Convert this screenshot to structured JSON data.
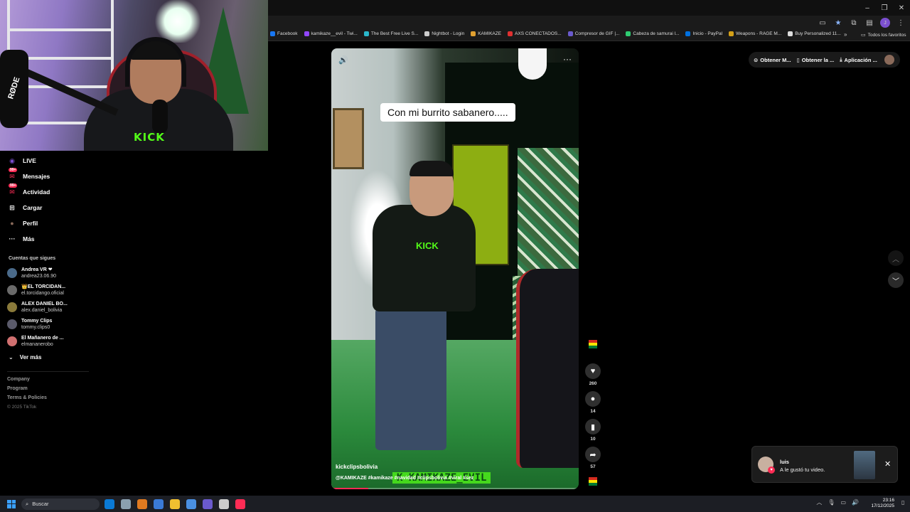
{
  "window": {
    "minimize": "–",
    "restore": "❐",
    "close": "✕"
  },
  "toolbar": {
    "cast_icon": "cast-icon",
    "star_icon": "★",
    "extensions_icon": "extensions-icon",
    "profile_initial": "J",
    "menu": "⋮"
  },
  "bookmarks": {
    "items": [
      {
        "label": "Facebook",
        "color": "#1877f2"
      },
      {
        "label": "kamikaze__evil - Twi...",
        "color": "#9146ff"
      },
      {
        "label": "The Best Free Live S...",
        "color": "#2ab7ca"
      },
      {
        "label": "Nightbot - Login",
        "color": "#cccccc"
      },
      {
        "label": "KAMIKAZE",
        "color": "#e0a030"
      },
      {
        "label": "AXS CONECTADOS...",
        "color": "#e03030"
      },
      {
        "label": "Compresor de GIF |...",
        "color": "#6a5acd"
      },
      {
        "label": "Cabeza de samurai l...",
        "color": "#2ecc71"
      },
      {
        "label": "Inicio - PayPal",
        "color": "#0070e0"
      },
      {
        "label": "Weapons - RAGE M...",
        "color": "#d4a017"
      },
      {
        "label": "Buy Personalized 11...",
        "color": "#dddddd"
      }
    ],
    "more": "»",
    "all_favorites": "Todos los favoritos"
  },
  "webcam": {
    "rode_label": "RØDE",
    "shirt_label": "KICK"
  },
  "sidebar": {
    "nav": [
      {
        "label": "LIVE",
        "icon": "live-icon",
        "glyph": "◉"
      },
      {
        "label": "Mensajes",
        "icon": "messages-icon",
        "glyph": "✉",
        "badge": "99+"
      },
      {
        "label": "Actividad",
        "icon": "activity-icon",
        "glyph": "✉",
        "badge": "99+"
      },
      {
        "label": "Cargar",
        "icon": "upload-icon",
        "glyph": "⊞"
      },
      {
        "label": "Perfil",
        "icon": "profile-avatar-icon",
        "glyph": "●"
      },
      {
        "label": "Más",
        "icon": "more-icon",
        "glyph": "···"
      }
    ],
    "following_title": "Cuentas que sigues",
    "following": [
      {
        "name": "Andrea VR ❤",
        "user": "andrea23.06.90",
        "color": "#4a6a8a"
      },
      {
        "name": "👑EL TORCIDAN...",
        "user": "el.torcidango.oficial",
        "color": "#6a6a6a"
      },
      {
        "name": "ALEX DANIEL BO...",
        "user": "alex.daniel_bolivia",
        "color": "#8a7a3a"
      },
      {
        "name": "Tommy Clips",
        "user": "tommy.clips0",
        "color": "#5a5a6a"
      },
      {
        "name": "El Mañanero de ...",
        "user": "elmananerobo",
        "color": "#d07070"
      }
    ],
    "see_more": "Ver más",
    "see_more_icon": "⌄",
    "footer": [
      "Company",
      "Program",
      "Terms & Policies"
    ],
    "copyright": "© 2025 TikTok"
  },
  "video": {
    "caption": "Con mi burrito sabanero.....",
    "author": "kickclipsbolivia",
    "tags": "@KAMIKAZE #kamikaze #navidad #clipsbolivia #viral #sez",
    "watermark": "K KAMIKAZE_EVIL",
    "shirt_label": "KICK",
    "sound_icon": "🔊",
    "more_icon": "···",
    "progress": 0.15
  },
  "actions": {
    "likes": "260",
    "comments": "14",
    "saves": "10",
    "shares": "57"
  },
  "top_actions": {
    "coins": "Obtener M...",
    "get_app": "Obtener la ...",
    "app": "Aplicación ..."
  },
  "notification": {
    "user": "luis",
    "text": "A le gustó tu video.",
    "close": "✕"
  },
  "taskbar": {
    "search": "Buscar",
    "time": "23:16",
    "date": "17/12/2025",
    "apps": [
      "#0a7ad6",
      "#8aa0b0",
      "#e07a20",
      "#3a7ad6",
      "#f0c030",
      "#4a90e2",
      "#6a5acd",
      "#cccccc",
      "#fe2c55"
    ]
  }
}
